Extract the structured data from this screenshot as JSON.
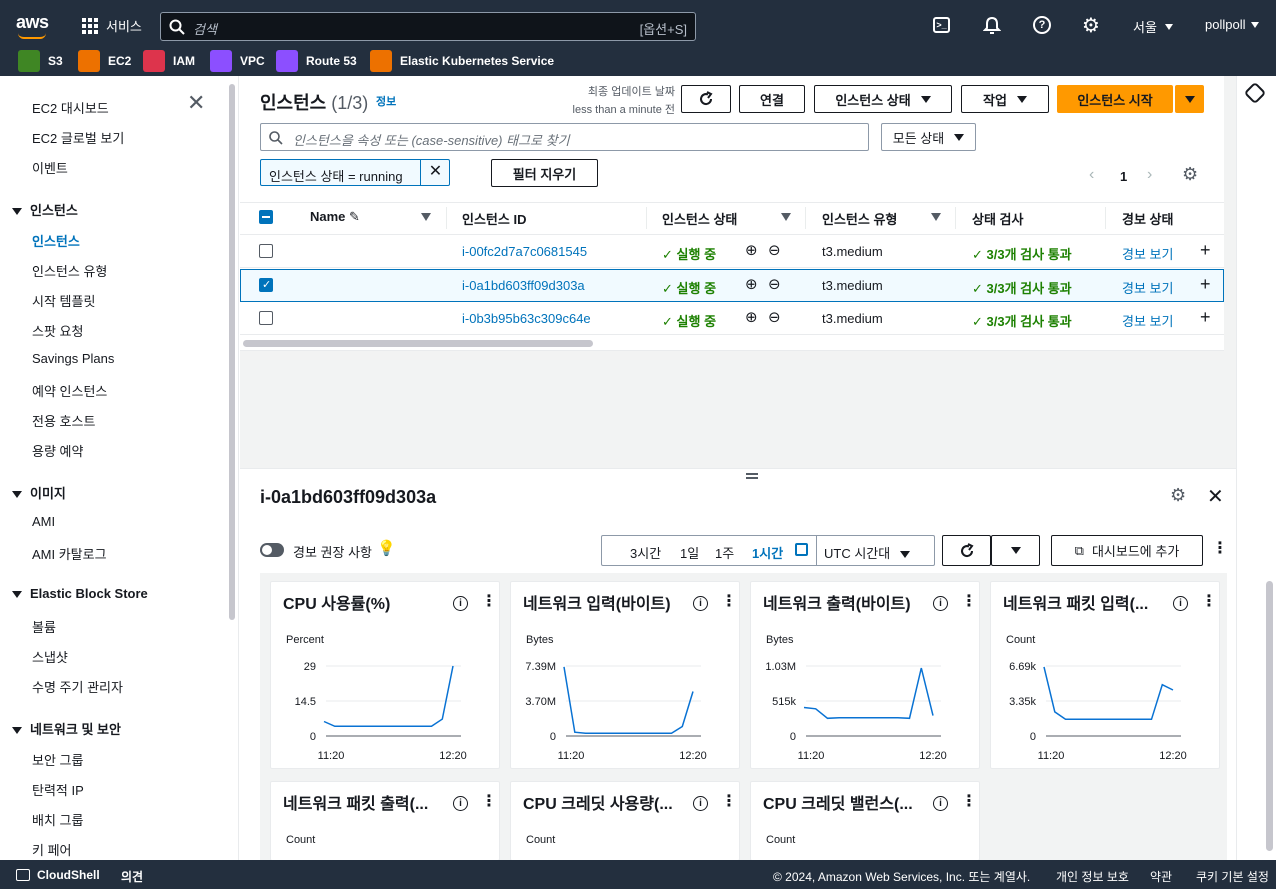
{
  "nav": {
    "logo": "aws",
    "services_label": "서비스",
    "search_placeholder": "검색",
    "search_shortcut": "[옵션+S]",
    "region": "서울",
    "user": "pollpoll"
  },
  "favorites": [
    {
      "label": "S3",
      "color": "#3f8624"
    },
    {
      "label": "EC2",
      "color": "#ed7100"
    },
    {
      "label": "IAM",
      "color": "#dd344c"
    },
    {
      "label": "VPC",
      "color": "#8c4fff"
    },
    {
      "label": "Route 53",
      "color": "#8c4fff"
    },
    {
      "label": "Elastic Kubernetes Service",
      "color": "#ed7100"
    }
  ],
  "sidebar": {
    "top": [
      "EC2 대시보드",
      "EC2 글로벌 보기",
      "이벤트"
    ],
    "sections": [
      {
        "title": "인스턴스",
        "items": [
          "인스턴스",
          "인스턴스 유형",
          "시작 템플릿",
          "스팟 요청",
          "Savings Plans",
          "예약 인스턴스",
          "전용 호스트",
          "용량 예약"
        ]
      },
      {
        "title": "이미지",
        "items": [
          "AMI",
          "AMI 카탈로그"
        ]
      },
      {
        "title": "Elastic Block Store",
        "items": [
          "볼륨",
          "스냅샷",
          "수명 주기 관리자"
        ]
      },
      {
        "title": "네트워크 및 보안",
        "items": [
          "보안 그룹",
          "탄력적 IP",
          "배치 그룹",
          "키 페어"
        ]
      }
    ]
  },
  "instances": {
    "title": "인스턴스",
    "count": "(1/3)",
    "info": "정보",
    "last_update_label": "최종 업데이트 날짜",
    "last_update_value": "less than a minute 전",
    "connect_btn": "연결",
    "state_btn": "인스턴스 상태",
    "actions_btn": "작업",
    "launch_btn": "인스턴스 시작",
    "search_placeholder": "인스턴스을 속성 또는 (case-sensitive) 태그로 찾기",
    "state_filter": "모든 상태",
    "filter_token": "인스턴스 상태 = running",
    "clear_filters": "필터 지우기",
    "page": "1",
    "columns": [
      "Name",
      "인스턴스 ID",
      "인스턴스 상태",
      "인스턴스 유형",
      "상태 검사",
      "경보 상태"
    ],
    "rows": [
      {
        "id": "i-00fc2d7a7c0681545",
        "state": "실행 중",
        "type": "t3.medium",
        "check": "3/3개 검사 통과",
        "alarm": "경보 보기",
        "selected": false
      },
      {
        "id": "i-0a1bd603ff09d303a",
        "state": "실행 중",
        "type": "t3.medium",
        "check": "3/3개 검사 통과",
        "alarm": "경보 보기",
        "selected": true
      },
      {
        "id": "i-0b3b95b63c309c64e",
        "state": "실행 중",
        "type": "t3.medium",
        "check": "3/3개 검사 통과",
        "alarm": "경보 보기",
        "selected": false
      }
    ]
  },
  "detail": {
    "instance_id": "i-0a1bd603ff09d303a",
    "alarm_reco": "경보 권장 사항",
    "ranges": [
      "3시간",
      "1일",
      "1주",
      "1시간"
    ],
    "timezone": "UTC 시간대",
    "add_dashboard": "대시보드에 추가",
    "cards": [
      {
        "title": "CPU 사용률(%)",
        "unit": "Percent",
        "yticks": [
          "29",
          "14.5",
          "0"
        ],
        "xticks": [
          "11:20",
          "12:20"
        ]
      },
      {
        "title": "네트워크 입력(바이트)",
        "unit": "Bytes",
        "yticks": [
          "7.39M",
          "3.70M",
          "0"
        ],
        "xticks": [
          "11:20",
          "12:20"
        ]
      },
      {
        "title": "네트워크 출력(바이트)",
        "unit": "Bytes",
        "yticks": [
          "1.03M",
          "515k",
          "0"
        ],
        "xticks": [
          "11:20",
          "12:20"
        ]
      },
      {
        "title": "네트워크 패킷 입력(...",
        "unit": "Count",
        "yticks": [
          "6.69k",
          "3.35k",
          "0"
        ],
        "xticks": [
          "11:20",
          "12:20"
        ]
      },
      {
        "title": "네트워크 패킷 출력(...",
        "unit": "Count"
      },
      {
        "title": "CPU 크레딧 사용량(...",
        "unit": "Count"
      },
      {
        "title": "CPU 크레딧 밸런스(...",
        "unit": "Count"
      }
    ]
  },
  "chart_data": [
    {
      "type": "line",
      "title": "CPU 사용률(%)",
      "ylabel": "Percent",
      "ylim": [
        0,
        29
      ],
      "x": [
        "11:20",
        "11:25",
        "11:30",
        "11:35",
        "11:40",
        "11:45",
        "11:50",
        "11:55",
        "12:00",
        "12:05",
        "12:10",
        "12:15",
        "12:20"
      ],
      "values": [
        6,
        4,
        4,
        4,
        4,
        4,
        4,
        4,
        4,
        4,
        4,
        7,
        29
      ]
    },
    {
      "type": "line",
      "title": "네트워크 입력(바이트)",
      "ylabel": "Bytes",
      "ylim": [
        0,
        7.39
      ],
      "x": [
        "11:20",
        "11:25",
        "11:30",
        "11:35",
        "11:40",
        "11:45",
        "11:50",
        "11:55",
        "12:00",
        "12:05",
        "12:10",
        "12:15",
        "12:20"
      ],
      "values": [
        7.3,
        0.4,
        0.3,
        0.3,
        0.3,
        0.3,
        0.3,
        0.3,
        0.3,
        0.3,
        0.3,
        1.0,
        4.7
      ]
    },
    {
      "type": "line",
      "title": "네트워크 출력(바이트)",
      "ylabel": "Bytes",
      "ylim": [
        0,
        1.03
      ],
      "x": [
        "11:20",
        "11:25",
        "11:30",
        "11:35",
        "11:40",
        "11:45",
        "11:50",
        "11:55",
        "12:00",
        "12:05",
        "12:10",
        "12:15",
        "12:20"
      ],
      "values": [
        0.42,
        0.4,
        0.26,
        0.27,
        0.27,
        0.27,
        0.27,
        0.27,
        0.27,
        0.26,
        1.0,
        0.3
      ]
    },
    {
      "type": "line",
      "title": "네트워크 패킷 입력(...",
      "ylabel": "Count",
      "ylim": [
        0,
        6.69
      ],
      "x": [
        "11:20",
        "11:25",
        "11:30",
        "11:35",
        "11:40",
        "11:45",
        "11:50",
        "11:55",
        "12:00",
        "12:05",
        "12:10",
        "12:15",
        "12:20"
      ],
      "values": [
        6.6,
        2.3,
        1.6,
        1.6,
        1.6,
        1.6,
        1.6,
        1.6,
        1.6,
        1.6,
        1.6,
        4.9,
        4.4
      ]
    }
  ],
  "footer": {
    "cloudshell": "CloudShell",
    "feedback": "의견",
    "copyright": "© 2024, Amazon Web Services, Inc. 또는 계열사.",
    "privacy": "개인 정보 보호",
    "terms": "약관",
    "cookies": "쿠키 기본 설정"
  }
}
